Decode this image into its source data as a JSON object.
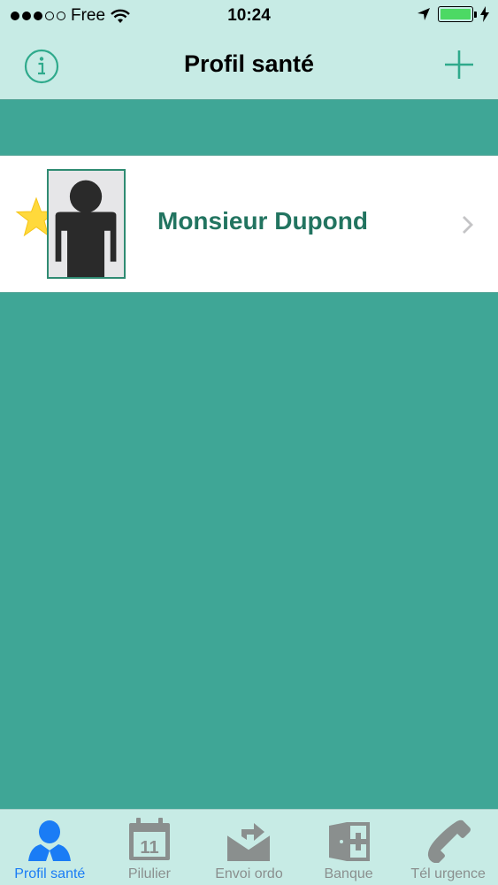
{
  "status_bar": {
    "carrier": "Free",
    "time": "10:24",
    "signal_bars_filled": 3,
    "signal_bars_total": 5,
    "battery_level": 1.0
  },
  "nav": {
    "title": "Profil santé",
    "left_icon": "info-icon",
    "right_icon": "plus-icon"
  },
  "profiles": [
    {
      "name": "Monsieur Dupond",
      "favorite": true,
      "avatar_icon": "person-silhouette-icon"
    }
  ],
  "tabs": [
    {
      "label": "Profil santé",
      "icon": "person-icon",
      "active": true
    },
    {
      "label": "Pilulier",
      "icon": "calendar-icon",
      "active": false,
      "badge_text": "11"
    },
    {
      "label": "Envoi ordo",
      "icon": "send-envelope-icon",
      "active": false
    },
    {
      "label": "Banque",
      "icon": "medical-door-icon",
      "active": false
    },
    {
      "label": "Tél urgence",
      "icon": "phone-icon",
      "active": false
    }
  ],
  "colors": {
    "header_bg": "#c7ebe5",
    "content_bg": "#3fa696",
    "accent_teal": "#2faa8c",
    "name_green": "#227460",
    "active_tab": "#1a7cf5",
    "inactive_tab": "#8a8f8e",
    "star": "#ffd93b"
  }
}
